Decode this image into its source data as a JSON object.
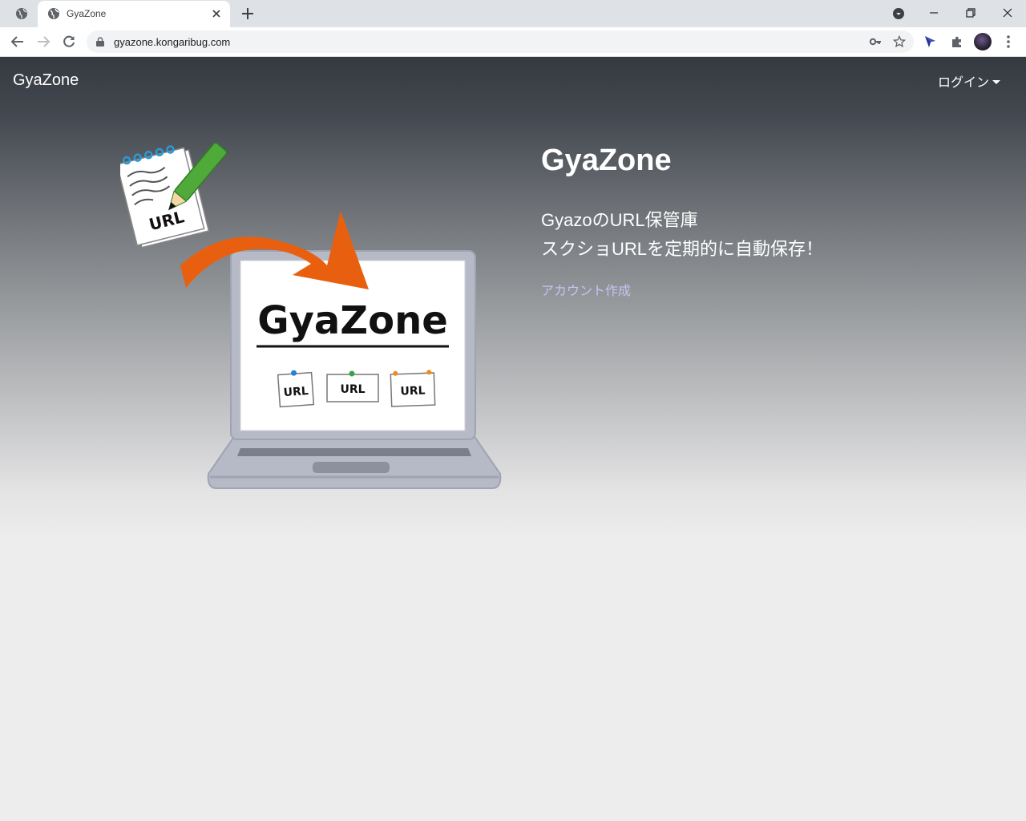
{
  "browser": {
    "tab": {
      "title": "GyaZone"
    },
    "address": {
      "url": "gyazone.kongaribug.com"
    }
  },
  "navbar": {
    "brand": "GyaZone",
    "login_label": "ログイン"
  },
  "hero": {
    "title": "GyaZone",
    "lead_line1": "GyazoのURL保管庫",
    "lead_line2": "スクショURLを定期的に自動保存！",
    "signup_link": "アカウント作成",
    "illustration": {
      "notepad_label": "URL",
      "screen_title": "GyaZone",
      "card_labels": [
        "URL",
        "URL",
        "URL"
      ]
    }
  },
  "colors": {
    "navbar_top": "#343a40",
    "page_background": "#ededed",
    "link": "#c5c3f5",
    "arrow": "#e8600f"
  }
}
